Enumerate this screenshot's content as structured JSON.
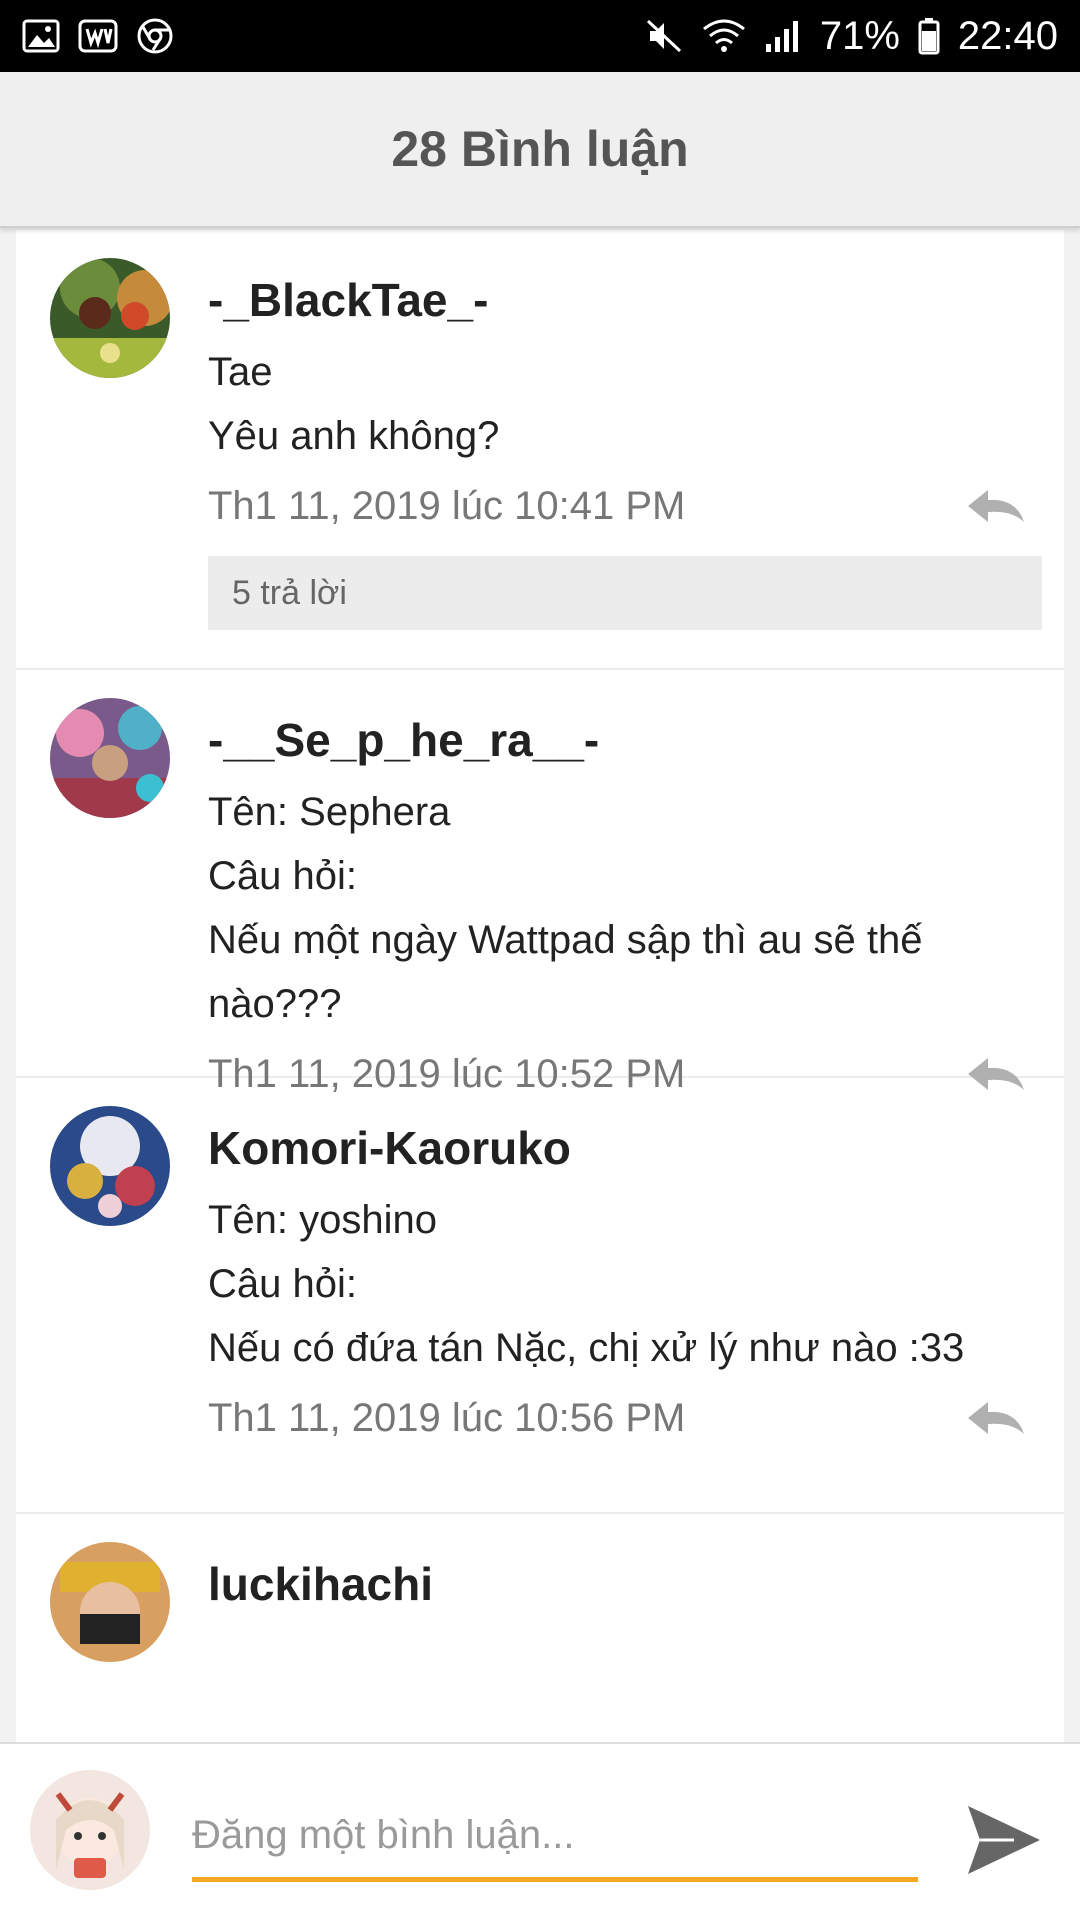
{
  "status_bar": {
    "battery": "71%",
    "time": "22:40",
    "icons_left": [
      "image-icon",
      "wattpad-icon",
      "chrome-icon"
    ],
    "icons_right": [
      "mute-icon",
      "wifi-icon",
      "signal-icon",
      "battery-icon"
    ]
  },
  "header": {
    "title": "28 Bình luận"
  },
  "comments": [
    {
      "username": "-_BlackTae_-",
      "lines": [
        "Tae",
        "Yêu anh không?"
      ],
      "date": "Th1 11, 2019 lúc 10:41 PM",
      "replies": "5 trả lời"
    },
    {
      "username": "-__Se_p_he_ra__-",
      "lines": [
        "Tên: Sephera",
        "Câu hỏi:",
        "Nếu một ngày Wattpad sập thì au sẽ thế",
        "nào???"
      ],
      "date": "Th1 11, 2019 lúc 10:52 PM"
    },
    {
      "username": "Komori-Kaoruko",
      "lines": [
        "Tên: yoshino",
        "Câu hỏi:",
        "Nếu có đứa tán Nặc, chị xử lý như nào :33"
      ],
      "date": "Th1 11, 2019 lúc 10:56 PM"
    },
    {
      "username": "luckihachi"
    }
  ],
  "footer": {
    "input_placeholder": "Đăng một bình luận...",
    "accent_color": "#f5a623"
  }
}
